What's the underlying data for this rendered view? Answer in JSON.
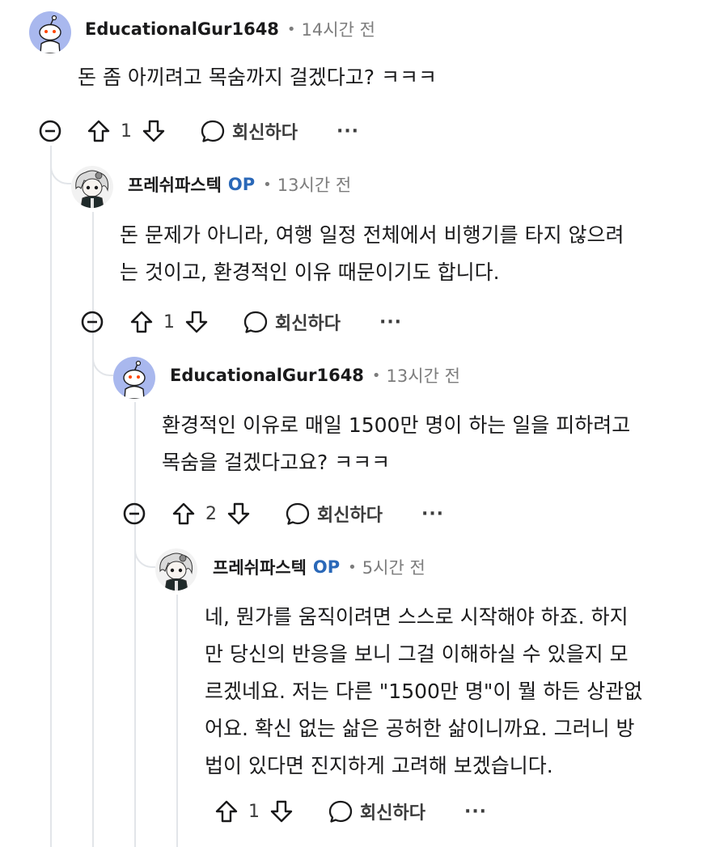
{
  "comments": [
    {
      "username": "EducationalGur1648",
      "is_op": false,
      "time": "14시간 전",
      "lines": [
        "돈 좀 아끼려고 목숨까지 걸겠다고? ㅋㅋㅋ"
      ],
      "votes": "1",
      "reply_label": "회신하다",
      "more_label": "···"
    },
    {
      "username": "프레쉬파스텍",
      "is_op": true,
      "op_label": "OP",
      "time": "13시간 전",
      "lines": [
        "돈 문제가 아니라, 여행 일정 전체에서 비행기를 타지 않으려",
        "는 것이고, 환경적인 이유 때문이기도 합니다."
      ],
      "votes": "1",
      "reply_label": "회신하다",
      "more_label": "···"
    },
    {
      "username": "EducationalGur1648",
      "is_op": false,
      "time": "13시간 전",
      "lines": [
        "환경적인 이유로 매일 1500만 명이 하는 일을 피하려고",
        "목숨을 걸겠다고요? ㅋㅋㅋ"
      ],
      "votes": "2",
      "reply_label": "회신하다",
      "more_label": "···"
    },
    {
      "username": "프레쉬파스텍",
      "is_op": true,
      "op_label": "OP",
      "time": "5시간 전",
      "lines": [
        "네, 뭔가를 움직이려면 스스로 시작해야 하죠. 하지",
        "만 당신의 반응을 보니 그걸 이해하실 수 있을지 모",
        "르겠네요. 저는 다른 \"1500만 명\"이 뭘 하든 상관없",
        "어요. 확신 없는 삶은 공허한 삶이니까요. 그러니 방",
        "법이 있다면 진지하게 고려해 보겠습니다."
      ],
      "votes": "1",
      "reply_label": "회신하다",
      "more_label": "···"
    }
  ],
  "colors": {
    "snoo_avatar_bg": "#a9b8ee",
    "op_blue": "#2a68b8",
    "meta_gray": "#7c7c7c",
    "thread_line": "#e2e5e9"
  }
}
